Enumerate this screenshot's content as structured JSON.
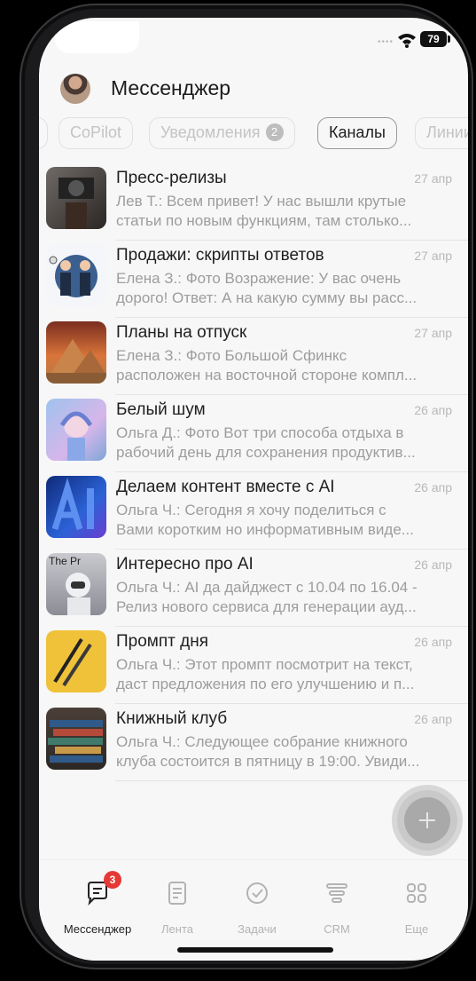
{
  "status_bar": {
    "battery": "79"
  },
  "header": {
    "title": "Мессенджер"
  },
  "tabs": [
    {
      "label": "CoPilot",
      "active": false
    },
    {
      "label": "Уведомления",
      "badge": "2",
      "active": false
    },
    {
      "label": "Каналы",
      "active": true
    },
    {
      "label": "Линии",
      "active": false
    }
  ],
  "chats": [
    {
      "title": "Пресс-релизы",
      "date": "27 апр",
      "line1": "Лев Т.: Всем привет! У нас вышли крутые",
      "line2": "статьи по новым функциям, там столько..."
    },
    {
      "title": "Продажи: скрипты ответов",
      "date": "27 апр",
      "line1": "Елена З.: Фото Возражение: У вас очень",
      "line2": "дорого! Ответ: А на какую сумму вы расс..."
    },
    {
      "title": "Планы на отпуск",
      "date": "27 апр",
      "line1": "Елена З.: Фото Большой Сфинкс",
      "line2": "расположен на восточной стороне компл..."
    },
    {
      "title": "Белый шум",
      "date": "26 апр",
      "line1": "Ольга Д.: Фото Вот три способа отдыха в",
      "line2": "рабочий день для сохранения продуктив..."
    },
    {
      "title": "Делаем контент вместе с AI",
      "date": "26 апр",
      "line1": "Ольга Ч.: Сегодня я хочу поделиться с",
      "line2": "Вами коротким но информативным виде..."
    },
    {
      "title": "Интересно про AI",
      "date": "26 апр",
      "line1": "Ольга Ч.: AI да дайджест с 10.04 по 16.04  -",
      "line2": "Релиз нового сервиса для генерации ауд...",
      "thumb_text": "The Pr"
    },
    {
      "title": "Промпт дня",
      "date": "26 апр",
      "line1": "Ольга Ч.: Этот промпт посмотрит на текст,",
      "line2": "даст предложения по его улучшению и п..."
    },
    {
      "title": "Книжный клуб",
      "date": "26 апр",
      "line1": "Ольга Ч.: Следующее собрание книжного",
      "line2": "клуба состоится в пятницу в 19:00. Увиди..."
    }
  ],
  "nav": [
    {
      "label": "Мессенджер",
      "icon": "chat-icon",
      "badge": "3",
      "active": true
    },
    {
      "label": "Лента",
      "icon": "feed-icon",
      "active": false
    },
    {
      "label": "Задачи",
      "icon": "tasks-icon",
      "active": false
    },
    {
      "label": "CRM",
      "icon": "crm-icon",
      "active": false
    },
    {
      "label": "Еще",
      "icon": "more-icon",
      "active": false
    }
  ],
  "colors": {
    "badge_red": "#e53935",
    "muted": "#b3b3b3"
  }
}
